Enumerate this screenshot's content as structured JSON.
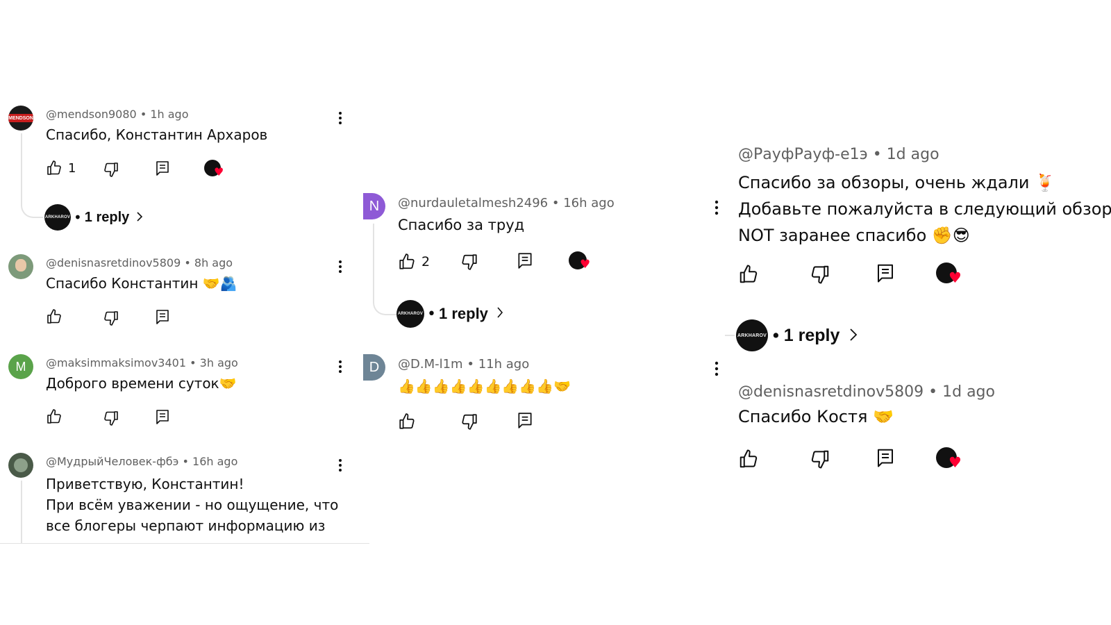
{
  "p1": {
    "comments": [
      {
        "handle": "@mendson9080",
        "time": "1h ago",
        "lines": [
          "Спасибо, Константин Архаров"
        ],
        "likes": "1",
        "reply_label": "1 reply",
        "avatar_text": "MENDSON"
      },
      {
        "handle": "@denisnasretdinov5809",
        "time": "8h ago",
        "lines": [
          "Спасибо Константин 🤝🫂"
        ]
      },
      {
        "handle": "@maksimmaksimov3401",
        "time": "3h ago",
        "lines": [
          "Доброго времени суток🤝"
        ],
        "avatar_letter": "M"
      },
      {
        "handle": "@МудрыйЧеловек-фбэ",
        "time": "16h ago",
        "lines": [
          "Приветствую, Константин!",
          "При всём уважении - но ощущение, что",
          "все блогеры черпают информацию из"
        ]
      }
    ]
  },
  "p2": {
    "comments": [
      {
        "handle": "@nurdauletalmesh2496",
        "time": "16h ago",
        "lines": [
          "Спасибо за труд"
        ],
        "likes": "2",
        "reply_label": "1 reply",
        "avatar_letter": "N"
      },
      {
        "handle": "@D.M-l1m",
        "time": "11h ago",
        "lines": [
          "👍👍👍👍👍👍👍👍👍🤝"
        ],
        "avatar_letter": "D"
      }
    ]
  },
  "p3": {
    "comments": [
      {
        "handle": "@РауфРауф-е1э",
        "time": "1d ago",
        "lines": [
          "Спасибо за обзоры, очень ждали 🍹",
          "Добавьте пожалуйста в следующий обзор",
          "NOT заранее спасибо ✊😎"
        ],
        "reply_label": "1 reply"
      },
      {
        "handle": "@denisnasretdinov5809",
        "time": "1d ago",
        "lines": [
          "Спасибо Костя 🤝"
        ]
      }
    ]
  },
  "arkharov_text": "ARKHAROV",
  "separator": "•",
  "colors": {
    "meta": "#606060",
    "text": "#0f0f0f",
    "heart": "#ff0033",
    "avatar_m": "#5aa34a",
    "avatar_n": "#8e5ad6",
    "avatar_d": "#6e8596"
  }
}
